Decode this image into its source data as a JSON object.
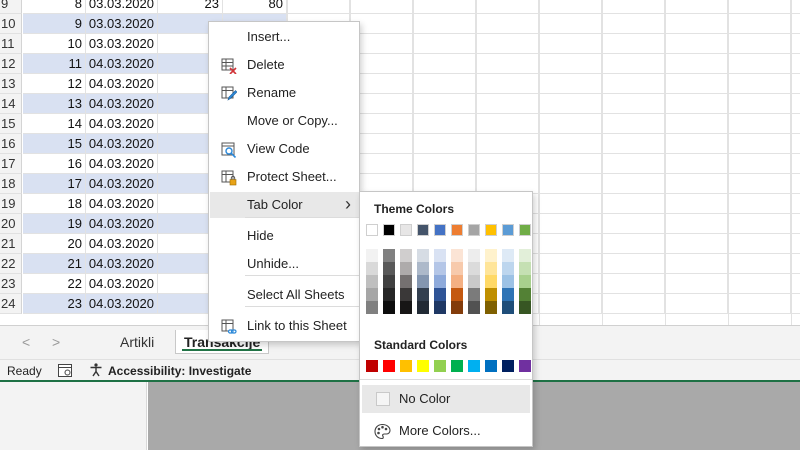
{
  "grid": {
    "rows": [
      {
        "rownum": "9",
        "id": "8",
        "date": "03.03.2020",
        "c": "23",
        "d": "80",
        "band": false
      },
      {
        "rownum": "10",
        "id": "9",
        "date": "03.03.2020",
        "c": "",
        "d": "",
        "band": true
      },
      {
        "rownum": "11",
        "id": "10",
        "date": "03.03.2020",
        "c": "",
        "d": "",
        "band": false
      },
      {
        "rownum": "12",
        "id": "11",
        "date": "04.03.2020",
        "c": "",
        "d": "",
        "band": true
      },
      {
        "rownum": "13",
        "id": "12",
        "date": "04.03.2020",
        "c": "",
        "d": "",
        "band": false
      },
      {
        "rownum": "14",
        "id": "13",
        "date": "04.03.2020",
        "c": "",
        "d": "",
        "band": true
      },
      {
        "rownum": "15",
        "id": "14",
        "date": "04.03.2020",
        "c": "",
        "d": "",
        "band": false
      },
      {
        "rownum": "16",
        "id": "15",
        "date": "04.03.2020",
        "c": "",
        "d": "",
        "band": true
      },
      {
        "rownum": "17",
        "id": "16",
        "date": "04.03.2020",
        "c": "",
        "d": "",
        "band": false
      },
      {
        "rownum": "18",
        "id": "17",
        "date": "04.03.2020",
        "c": "",
        "d": "",
        "band": true
      },
      {
        "rownum": "19",
        "id": "18",
        "date": "04.03.2020",
        "c": "",
        "d": "",
        "band": false
      },
      {
        "rownum": "20",
        "id": "19",
        "date": "04.03.2020",
        "c": "",
        "d": "",
        "band": true
      },
      {
        "rownum": "21",
        "id": "20",
        "date": "04.03.2020",
        "c": "",
        "d": "",
        "band": false
      },
      {
        "rownum": "22",
        "id": "21",
        "date": "04.03.2020",
        "c": "",
        "d": "",
        "band": true
      },
      {
        "rownum": "23",
        "id": "22",
        "date": "04.03.2020",
        "c": "",
        "d": "",
        "band": false
      },
      {
        "rownum": "24",
        "id": "23",
        "date": "04.03.2020",
        "c": "",
        "d": "",
        "band": true
      }
    ]
  },
  "tabs": {
    "nav_prev": "<",
    "nav_next": ">",
    "sheets": [
      "Artikli",
      "Transakcije"
    ],
    "active": "Transakcije"
  },
  "status": {
    "ready": "Ready",
    "accessibility": "Accessibility: Investigate"
  },
  "context_menu": {
    "items": [
      {
        "label": "Insert...",
        "icon": ""
      },
      {
        "label": "Delete",
        "icon": "delete-sheet-icon"
      },
      {
        "label": "Rename",
        "icon": "rename-icon"
      },
      {
        "label": "Move or Copy...",
        "icon": ""
      },
      {
        "label": "View Code",
        "icon": "view-code-icon"
      },
      {
        "label": "Protect Sheet...",
        "icon": "protect-sheet-icon"
      },
      {
        "label": "Tab Color",
        "icon": "",
        "submenu": true
      },
      {
        "label": "Hide",
        "icon": ""
      },
      {
        "label": "Unhide...",
        "icon": ""
      },
      {
        "label": "Select All Sheets",
        "icon": ""
      },
      {
        "label": "Link to this Sheet",
        "icon": "link-sheet-icon"
      }
    ],
    "highlighted": "Tab Color"
  },
  "palette": {
    "theme_title": "Theme Colors",
    "standard_title": "Standard Colors",
    "no_color": "No Color",
    "more_colors": "More Colors...",
    "theme_base": [
      "#ffffff",
      "#000000",
      "#e7e6e6",
      "#44546a",
      "#4472c4",
      "#ed7d31",
      "#a5a5a5",
      "#ffc000",
      "#5b9bd5",
      "#70ad47"
    ],
    "theme_shades": [
      [
        "#f2f2f2",
        "#808080",
        "#d0cece",
        "#d6dce4",
        "#d9e2f3",
        "#fbe4d5",
        "#ededed",
        "#fff2cc",
        "#deeaf6",
        "#e2efd9"
      ],
      [
        "#d9d9d9",
        "#595959",
        "#aeabab",
        "#adb9ca",
        "#b4c6e7",
        "#f7caac",
        "#dbdbdb",
        "#ffe599",
        "#bdd6ee",
        "#c5e0b3"
      ],
      [
        "#bfbfbf",
        "#404040",
        "#757171",
        "#8496b0",
        "#8eaadb",
        "#f4b083",
        "#c9c9c9",
        "#ffd966",
        "#9cc2e5",
        "#a8d08d"
      ],
      [
        "#a6a6a6",
        "#262626",
        "#3a3838",
        "#333f4f",
        "#2f5496",
        "#c45911",
        "#7b7b7b",
        "#bf8f00",
        "#2e74b5",
        "#538135"
      ],
      [
        "#808080",
        "#0d0d0d",
        "#171616",
        "#222a35",
        "#1f3864",
        "#833c0b",
        "#525252",
        "#7f6000",
        "#1f4e79",
        "#375623"
      ]
    ],
    "standard": [
      "#c00000",
      "#ff0000",
      "#ffc000",
      "#ffff00",
      "#92d050",
      "#00b050",
      "#00b0f0",
      "#0070c0",
      "#002060",
      "#7030a0"
    ]
  }
}
